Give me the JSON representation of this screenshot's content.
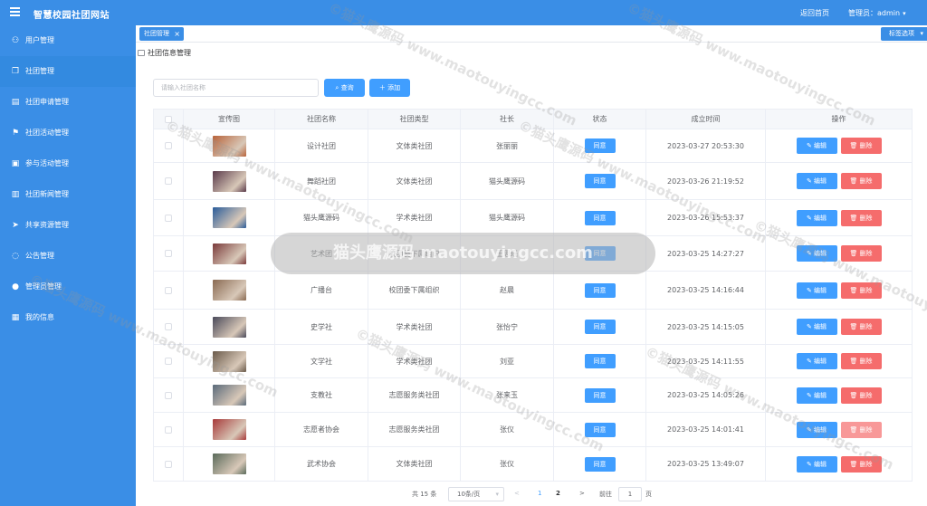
{
  "header": {
    "title": "智慧校园社团网站",
    "back_home": "返回首页",
    "admin_label": "管理员：admin",
    "caret": "▾"
  },
  "sidebar": {
    "items": [
      {
        "label": "用户管理",
        "icon": "user-icon",
        "glyph": "⚇",
        "active": false
      },
      {
        "label": "社团管理",
        "icon": "copy-icon",
        "glyph": "❐",
        "active": true
      },
      {
        "label": "社团申请管理",
        "icon": "document-icon",
        "glyph": "▤",
        "active": false
      },
      {
        "label": "社团活动管理",
        "icon": "flag-icon",
        "glyph": "⚑",
        "active": false
      },
      {
        "label": "参与活动管理",
        "icon": "suitcase-icon",
        "glyph": "▣",
        "active": false
      },
      {
        "label": "社团新闻管理",
        "icon": "book-icon",
        "glyph": "▥",
        "active": false
      },
      {
        "label": "共享资源管理",
        "icon": "send-icon",
        "glyph": "➤",
        "active": false
      },
      {
        "label": "公告管理",
        "icon": "chat-icon",
        "glyph": "◌",
        "active": false
      },
      {
        "label": "管理员管理",
        "icon": "person-icon",
        "glyph": "●",
        "active": false
      },
      {
        "label": "我的信息",
        "icon": "clipboard-icon",
        "glyph": "▦",
        "active": false
      }
    ]
  },
  "tabs": {
    "active_tab": "社团管理",
    "close": "×",
    "options_label": "标签选项"
  },
  "breadcrumb": "社团信息管理",
  "search": {
    "placeholder": "请输入社团名称",
    "query_label": "查询",
    "add_label": "添加"
  },
  "table": {
    "columns": [
      "",
      "宣传图",
      "社团名称",
      "社团类型",
      "社长",
      "状态",
      "成立时间",
      "操作"
    ],
    "edit_label": "编辑",
    "delete_label": "删除",
    "rows": [
      {
        "name": "设计社团",
        "type": "文体类社团",
        "president": "张丽丽",
        "status": "同意",
        "created": "2023-03-27 20:53:30",
        "thumb_color": "#b8633a"
      },
      {
        "name": "舞蹈社团",
        "type": "文体类社团",
        "president": "猫头鹰源码",
        "status": "同意",
        "created": "2023-03-26 21:19:52",
        "thumb_color": "#5a3a4a"
      },
      {
        "name": "猫头鹰源码",
        "type": "学术类社团",
        "president": "猫头鹰源码",
        "status": "同意",
        "created": "2023-03-26 15:53:37",
        "thumb_color": "#2a5c9a"
      },
      {
        "name": "艺术团",
        "type": "校团委下属组织",
        "president": "王思瑶",
        "status": "同意",
        "created": "2023-03-25 14:27:27",
        "thumb_color": "#7a3a3a"
      },
      {
        "name": "广播台",
        "type": "校团委下属组织",
        "president": "赵晨",
        "status": "同意",
        "created": "2023-03-25 14:16:44",
        "thumb_color": "#8a6a52"
      },
      {
        "name": "史学社",
        "type": "学术类社团",
        "president": "张怡宁",
        "status": "同意",
        "created": "2023-03-25 14:15:05",
        "thumb_color": "#4a4a5a"
      },
      {
        "name": "文学社",
        "type": "学术类社团",
        "president": "刘亚",
        "status": "同意",
        "created": "2023-03-25 14:11:55",
        "thumb_color": "#6a5a4a"
      },
      {
        "name": "支教社",
        "type": "志愿服务类社团",
        "president": "张来玉",
        "status": "同意",
        "created": "2023-03-25 14:05:26",
        "thumb_color": "#5a6a7a"
      },
      {
        "name": "志愿者协会",
        "type": "志愿服务类社团",
        "president": "张仪",
        "status": "同意",
        "created": "2023-03-25 14:01:41",
        "thumb_color": "#a83a3a"
      },
      {
        "name": "武术协会",
        "type": "文体类社团",
        "president": "张仪",
        "status": "同意",
        "created": "2023-03-25 13:49:07",
        "thumb_color": "#5a6a5a"
      }
    ]
  },
  "pagination": {
    "total": "共 15 条",
    "page_size": "10条/页",
    "prev": "<",
    "page1": "1",
    "page2": "2",
    "next": ">",
    "goto": "前往",
    "goto_value": "1",
    "page_unit": "页"
  },
  "watermark": {
    "banner": "猫头鹰源码 maotouyingcc.com",
    "site": "©猫头鹰源码 www.maotouyingcc.com"
  }
}
